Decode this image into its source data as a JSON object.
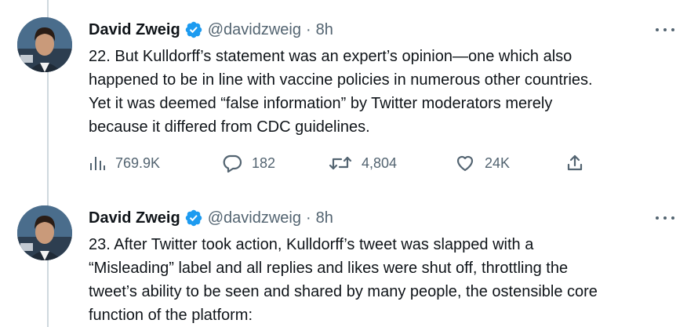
{
  "tweets": [
    {
      "author_name": "David Zweig",
      "handle": "@davidzweig",
      "separator": "·",
      "time": "8h",
      "text": "22. But Kulldorff’s statement was an expert’s opinion—one which also\nhappened to be in line with vaccine policies in numerous other countries.\nYet it was deemed “false information” by Twitter moderators merely\nbecause it differed from CDC guidelines.",
      "views": "769.9K",
      "replies": "182",
      "retweets": "4,804",
      "likes": "24K"
    },
    {
      "author_name": "David Zweig",
      "handle": "@davidzweig",
      "separator": "·",
      "time": "8h",
      "text": "23. After Twitter took action, Kulldorff’s tweet was slapped with a\n“Misleading” label and all replies and likes were shut off, throttling the\ntweet’s ability to be seen and shared by many people, the ostensible core\nfunction of the platform:"
    }
  ],
  "colors": {
    "verified": "#1d9bf0",
    "secondary_text": "#536471",
    "primary_text": "#0f1419",
    "thread_line": "#cfd9de"
  },
  "icons": [
    "verified-badge-icon",
    "more-icon",
    "views-icon",
    "reply-icon",
    "retweet-icon",
    "like-icon",
    "share-icon"
  ]
}
